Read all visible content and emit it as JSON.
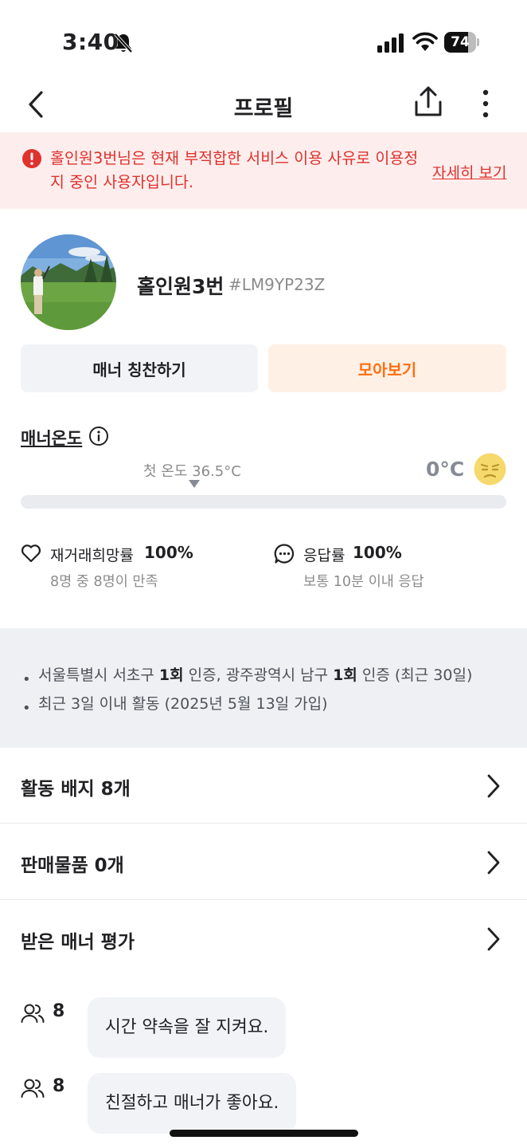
{
  "status_bar": {
    "time": "3:40",
    "battery": "74",
    "battery_level": 0.74
  },
  "nav": {
    "title": "프로필"
  },
  "warning": {
    "message": "홀인원3번님은 현재 부적합한 서비스 이용 사유로 이용정지 중인 사용자입니다.",
    "link": "자세히 보기",
    "color": "#e0312d"
  },
  "profile": {
    "name": "홀인원3번",
    "id": "#LM9YP23Z"
  },
  "actions": {
    "praise": "매너 칭찬하기",
    "collect": "모아보기"
  },
  "manner": {
    "title": "매너온도",
    "first_temp_label": "첫 온도 36.5°C",
    "current_temp": "0°C",
    "temp_level": 0
  },
  "stats": {
    "rehire": {
      "label": "재거래희망률",
      "value": "100%",
      "sub": "8명 중 8명이 만족"
    },
    "response": {
      "label": "응답률",
      "value": "100%",
      "sub": "보통 10분 이내 응답"
    }
  },
  "info": {
    "line1": {
      "part1": "서울특별시 서초구 ",
      "count1": "1회",
      "part2": " 인증, 광주광역시 남구 ",
      "count2": "1회",
      "part3": " 인증 (최근 30일)"
    },
    "line2": "최근 3일 이내 활동 (2025년 5월 13일 가입)"
  },
  "menu": {
    "badges": "활동 배지 8개",
    "items": "판매물품 0개",
    "reviews": "받은 매너 평가"
  },
  "reviews": [
    {
      "count": "8",
      "text": "시간 약속을 잘 지켜요."
    },
    {
      "count": "8",
      "text": "친절하고 매너가 좋아요."
    }
  ],
  "colors": {
    "accent": "#ff6f0f",
    "warning_bg": "#fdeeed"
  },
  "icons": [
    "bell-slash-icon",
    "signal-icon",
    "wifi-icon",
    "back-icon",
    "share-icon",
    "more-icon",
    "warning-icon",
    "info-icon",
    "frown-icon",
    "heart-icon",
    "chat-icon",
    "chevron-right-icon",
    "people-icon"
  ]
}
